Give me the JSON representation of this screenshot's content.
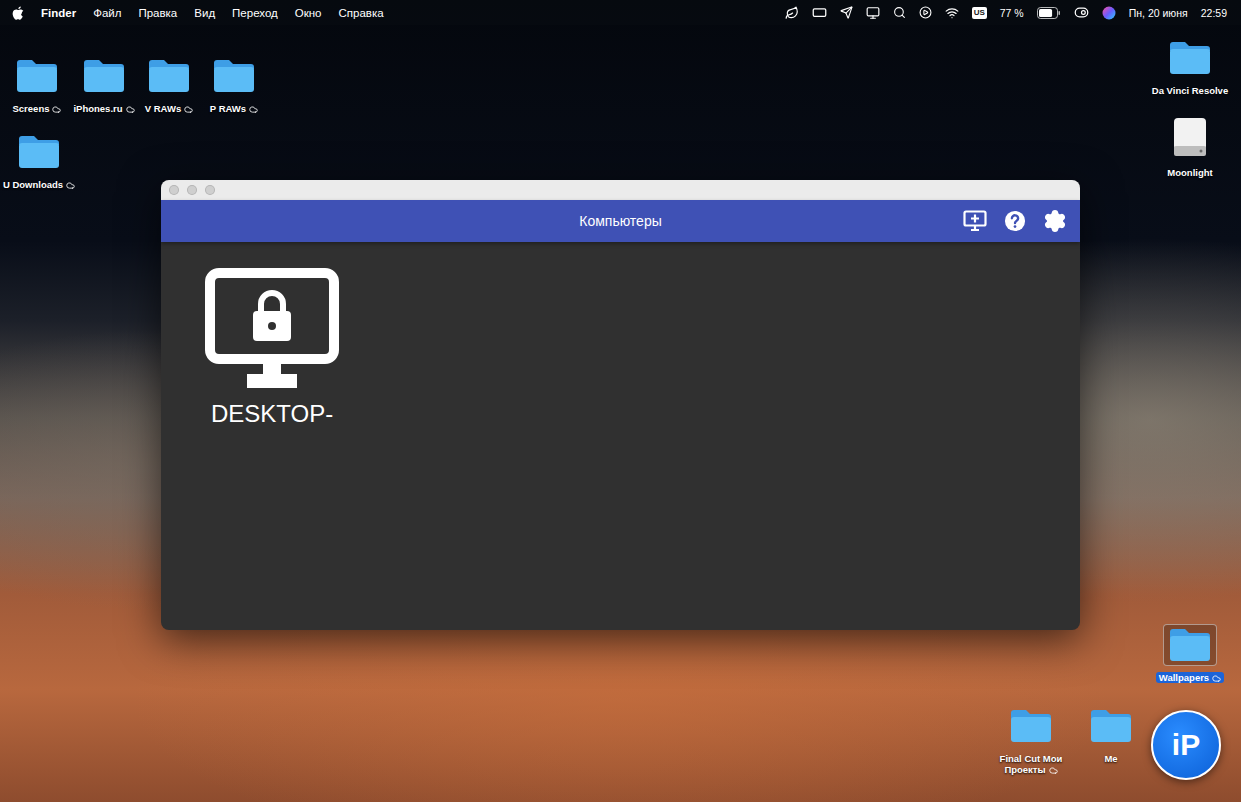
{
  "menubar": {
    "items": [
      {
        "label": "Finder",
        "bold": true
      },
      {
        "label": "Файл",
        "bold": false
      },
      {
        "label": "Правка",
        "bold": false
      },
      {
        "label": "Вид",
        "bold": false
      },
      {
        "label": "Переход",
        "bold": false
      },
      {
        "label": "Окно",
        "bold": false
      },
      {
        "label": "Справка",
        "bold": false
      }
    ],
    "keyboard": "US",
    "battery": {
      "reading": "77 %",
      "level": 0.77
    },
    "date": "Пн, 20 июня",
    "time": "22:59"
  },
  "desktop_icons": [
    {
      "label": "Screens",
      "kind": "folder",
      "cloud": true,
      "selected": false
    },
    {
      "label": "iPhones.ru",
      "kind": "folder",
      "cloud": true,
      "selected": false
    },
    {
      "label": "V RAWs",
      "kind": "folder",
      "cloud": true,
      "selected": false
    },
    {
      "label": "P RAWs",
      "kind": "folder",
      "cloud": true,
      "selected": false
    },
    {
      "label": "U Downloads",
      "kind": "folder",
      "cloud": true,
      "selected": false
    },
    {
      "label": "Da Vinci Resolve",
      "kind": "folder",
      "cloud": false,
      "selected": false
    },
    {
      "label": "Moonlight",
      "kind": "disk",
      "cloud": false,
      "selected": false
    },
    {
      "label": "Wallpapers",
      "kind": "folder",
      "cloud": true,
      "selected": true
    },
    {
      "label": "Final Cut Мои Проекты",
      "kind": "folder",
      "cloud": true,
      "selected": false
    },
    {
      "label": "Me",
      "kind": "folder",
      "cloud": false,
      "selected": false
    }
  ],
  "window": {
    "title": "Компьютеры",
    "active": false,
    "computers": [
      {
        "name": "DESKTOP-",
        "locked": true
      }
    ]
  },
  "watermark": "iP"
}
